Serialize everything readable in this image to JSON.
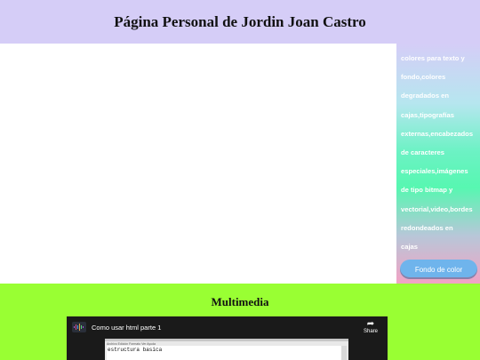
{
  "header": {
    "title": "Página Personal de Jordin Joan Castro"
  },
  "aside": {
    "lines": [
      "colores para texto y",
      "fondo,colores",
      "degradados en",
      "cajas,tipografías",
      "externas,encabezados",
      "de caracteres",
      "especiales,imágenes",
      "de tipo bitmap y",
      "vectorial,video,bordes",
      "redondeados en",
      "cajas"
    ],
    "button_label": "Fondo de color"
  },
  "multimedia": {
    "heading": "Multimedia",
    "video": {
      "title": "Como usar html parte 1",
      "share_label": "Share",
      "menu_text": "Archivo  Edición  Formato  Ver  Ayuda",
      "code_text": "estructura basica"
    }
  },
  "colors": {
    "header_bg": "#d5cdf7",
    "multimedia_bg": "#99ff33",
    "button_bg": "#6fb4ec"
  }
}
